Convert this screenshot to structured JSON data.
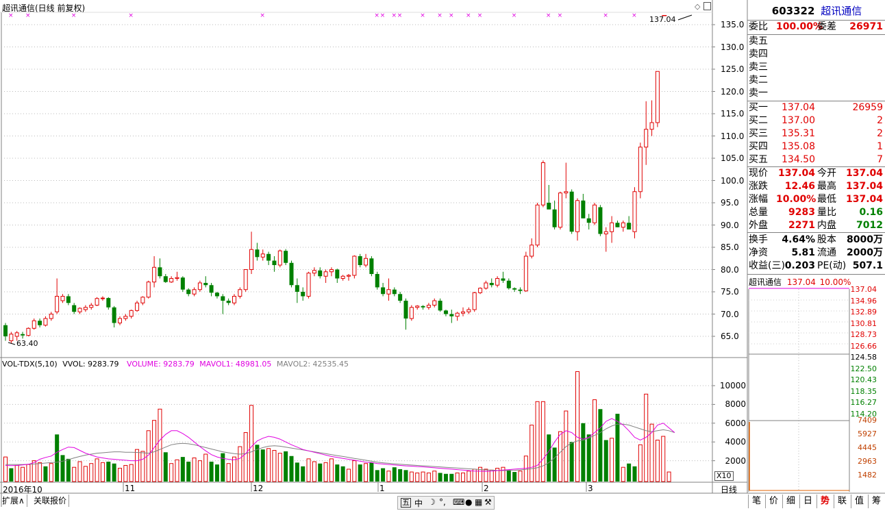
{
  "chart_header": {
    "title": "超讯通信(日线 前复权)"
  },
  "price_axis": [
    "135.0",
    "130.0",
    "125.0",
    "120.0",
    "115.0",
    "110.0",
    "105.0",
    "100.0",
    "95.0",
    "90.0",
    "85.0",
    "80.0",
    "75.0",
    "70.0",
    "65.0"
  ],
  "annotations": {
    "last_price": "137.04",
    "low_price": "63.40"
  },
  "volume_header": {
    "indicator": "VOL-TDX(5,10)",
    "vvol": "VVOL: 9283.79",
    "volume": "VOLUME: 9283.79",
    "mavol1": "MAVOL1: 48981.05",
    "mavol2": "MAVOL2: 42535.45"
  },
  "volume_axis": [
    "10000",
    "8000",
    "6000",
    "4000",
    "2000"
  ],
  "volume_unit": "X10",
  "date_axis": [
    "2016年10",
    "11",
    "12",
    "1",
    "2",
    "3"
  ],
  "period_label": "日线",
  "quote": {
    "code": "603322",
    "name": "超讯通信",
    "weibi_label": "委比",
    "weibi_value": "100.00%",
    "weicha_label": "委差",
    "weicha_value": "26971",
    "sell": [
      {
        "label": "卖五",
        "price": "",
        "vol": ""
      },
      {
        "label": "卖四",
        "price": "",
        "vol": ""
      },
      {
        "label": "卖三",
        "price": "",
        "vol": ""
      },
      {
        "label": "卖二",
        "price": "",
        "vol": ""
      },
      {
        "label": "卖一",
        "price": "",
        "vol": ""
      }
    ],
    "buy": [
      {
        "label": "买一",
        "price": "137.04",
        "vol": "26959"
      },
      {
        "label": "买二",
        "price": "137.00",
        "vol": "2"
      },
      {
        "label": "买三",
        "price": "135.31",
        "vol": "2"
      },
      {
        "label": "买四",
        "price": "135.08",
        "vol": "1"
      },
      {
        "label": "买五",
        "price": "134.50",
        "vol": "7"
      }
    ],
    "stats": [
      {
        "l1": "现价",
        "v1": "137.04",
        "l2": "今开",
        "v2": "137.04"
      },
      {
        "l1": "涨跌",
        "v1": "12.46",
        "l2": "最高",
        "v2": "137.04"
      },
      {
        "l1": "涨幅",
        "v1": "10.00%",
        "l2": "最低",
        "v2": "137.04"
      },
      {
        "l1": "总量",
        "v1": "9283",
        "l2": "量比",
        "v2": "0.16"
      },
      {
        "l1": "外盘",
        "v1": "2271",
        "l2": "内盘",
        "v2": "7012"
      }
    ],
    "stats2": [
      {
        "l1": "换手",
        "v1": "4.64%",
        "l2": "股本",
        "v2": "8000万"
      },
      {
        "l1": "净资",
        "v1": "5.81",
        "l2": "流通",
        "v2": "2000万"
      },
      {
        "l1": "收益(三)",
        "v1": "0.203",
        "l2": "PE(动)",
        "v2": "507.1"
      }
    ]
  },
  "mini_chart": {
    "name": "超讯通信",
    "price": "137.04",
    "pct": "10.00%",
    "price_ticks": [
      "137.04",
      "134.96",
      "132.89",
      "130.81",
      "128.73",
      "126.66",
      "124.58",
      "122.50",
      "120.43",
      "118.35",
      "116.27",
      "114.20"
    ],
    "vol_ticks": [
      "7409",
      "5927",
      "4445",
      "2963",
      "1482"
    ]
  },
  "bottom_tabs": {
    "expand": "扩展∧",
    "related": "关联报价"
  },
  "right_tabs": [
    "笔",
    "价",
    "细",
    "日",
    "势",
    "联",
    "值",
    "筹"
  ],
  "toolbar_icons": [
    "五",
    "中"
  ],
  "colors": {
    "up": "#e00000",
    "down": "#008000",
    "ma1": "#e000e0",
    "ma2": "#808080",
    "marker": "#e000e0"
  },
  "chart_data": {
    "type": "candlestick",
    "title": "超讯通信(日线 前复权)",
    "ylim": [
      62,
      137
    ],
    "x_labels": [
      "2016年10",
      "11",
      "12",
      "1",
      "2",
      "3"
    ],
    "candles": [
      [
        67.5,
        68,
        64,
        65
      ],
      [
        64,
        66,
        63.4,
        65.5
      ],
      [
        65,
        66.2,
        64,
        65.8
      ],
      [
        65.5,
        66,
        64.5,
        65.2
      ],
      [
        65.2,
        67,
        65,
        66.8
      ],
      [
        66.8,
        69,
        66.5,
        68.5
      ],
      [
        68.5,
        69,
        67,
        67.5
      ],
      [
        67.5,
        69.5,
        67.2,
        69
      ],
      [
        69,
        70.5,
        68.5,
        70
      ],
      [
        70.5,
        78,
        70,
        74
      ],
      [
        73,
        74.5,
        72.5,
        74
      ],
      [
        74,
        74.5,
        72,
        72.5
      ],
      [
        72,
        72.5,
        70,
        70.5
      ],
      [
        70.5,
        71.5,
        70,
        71.3
      ],
      [
        71,
        72,
        70.5,
        71.5
      ],
      [
        71.5,
        72.5,
        71,
        72
      ],
      [
        72,
        73.8,
        71.8,
        73.5
      ],
      [
        73.5,
        74,
        73,
        73.6
      ],
      [
        73.6,
        73.8,
        71,
        71.5
      ],
      [
        71.5,
        71.8,
        67,
        68
      ],
      [
        68,
        69.5,
        67.5,
        69
      ],
      [
        69,
        70,
        68.5,
        69.5
      ],
      [
        69.5,
        71,
        69,
        70.8
      ],
      [
        70.8,
        73,
        70.5,
        72.5
      ],
      [
        72.5,
        74,
        72,
        73.8
      ],
      [
        73.8,
        77.5,
        73.5,
        77.2
      ],
      [
        77.2,
        83,
        76,
        80.5
      ],
      [
        80.5,
        82.5,
        78,
        78.5
      ],
      [
        78.5,
        79,
        77,
        77.2
      ],
      [
        77.2,
        78.5,
        77,
        78
      ],
      [
        78,
        79.5,
        77.5,
        78.2
      ],
      [
        78.2,
        78.5,
        75,
        75.5
      ],
      [
        75.5,
        75.8,
        74,
        74.5
      ],
      [
        74.5,
        76,
        74,
        75.5
      ],
      [
        75.5,
        77.5,
        75,
        77
      ],
      [
        77,
        78.5,
        76,
        76.5
      ],
      [
        76.5,
        77,
        74,
        74.8
      ],
      [
        74.8,
        75,
        73.5,
        74
      ],
      [
        74,
        74.5,
        70,
        73
      ],
      [
        73,
        73.5,
        72,
        72.5
      ],
      [
        72.5,
        74.5,
        72,
        74
      ],
      [
        74,
        76,
        73.5,
        75.5
      ],
      [
        75.5,
        80,
        75,
        80
      ],
      [
        80,
        88.5,
        79,
        84.5
      ],
      [
        84.5,
        86,
        82,
        82.8
      ],
      [
        82.8,
        84.5,
        82,
        83.5
      ],
      [
        83.5,
        84,
        81,
        82
      ],
      [
        82,
        83,
        79.5,
        81
      ],
      [
        81,
        84.5,
        80.5,
        84.2
      ],
      [
        84.2,
        84.6,
        81,
        81.5
      ],
      [
        81.5,
        82,
        76,
        76.5
      ],
      [
        76.5,
        78,
        72.5,
        75
      ],
      [
        75,
        76,
        73,
        74
      ],
      [
        74,
        79.5,
        73.5,
        79.2
      ],
      [
        79.2,
        80.5,
        78.5,
        79.8
      ],
      [
        79.8,
        80.5,
        78,
        78.5
      ],
      [
        78.5,
        80,
        77,
        79.5
      ],
      [
        79.5,
        80.5,
        78.5,
        80
      ],
      [
        80,
        80.2,
        77,
        78
      ],
      [
        78,
        78.8,
        77.5,
        78.5
      ],
      [
        78.5,
        79,
        77.5,
        78.7
      ],
      [
        78.7,
        83.2,
        78,
        83
      ],
      [
        83,
        83.5,
        80.5,
        81
      ],
      [
        81,
        83.5,
        80.5,
        82.5
      ],
      [
        82.5,
        83,
        78.5,
        79
      ],
      [
        79,
        79.5,
        75.5,
        76
      ],
      [
        76,
        77,
        74,
        74.5
      ],
      [
        74.5,
        78,
        73,
        75.5
      ],
      [
        75.5,
        76,
        74,
        74.5
      ],
      [
        74.5,
        75,
        72.5,
        73
      ],
      [
        73,
        73.5,
        66.5,
        69
      ],
      [
        69,
        72,
        68.5,
        71.5
      ],
      [
        71.5,
        72,
        71,
        71.8
      ],
      [
        71.8,
        72,
        71,
        71.5
      ],
      [
        71.5,
        72.5,
        71,
        72
      ],
      [
        72,
        73.5,
        71.5,
        73
      ],
      [
        73,
        73.5,
        70.5,
        70.8
      ],
      [
        70.8,
        71,
        69.5,
        70
      ],
      [
        70,
        71,
        68,
        69.5
      ],
      [
        69.5,
        70.5,
        68.5,
        70.2
      ],
      [
        70.2,
        71.5,
        69.5,
        70.5
      ],
      [
        70.5,
        71.5,
        70,
        71
      ],
      [
        71,
        75,
        70.5,
        74.8
      ],
      [
        74.8,
        76,
        74.5,
        75.8
      ],
      [
        75.8,
        77.5,
        75.5,
        77
      ],
      [
        77,
        78,
        76,
        76.5
      ],
      [
        76.5,
        78.5,
        76,
        78
      ],
      [
        78,
        79.5,
        77,
        77.5
      ],
      [
        77.5,
        78,
        75.5,
        75.8
      ],
      [
        75.8,
        76,
        75,
        75.5
      ],
      [
        75.5,
        76,
        74.5,
        75.2
      ],
      [
        75.2,
        84,
        75,
        83
      ],
      [
        83,
        87,
        82.5,
        85.5
      ],
      [
        85.5,
        95,
        85,
        94.5
      ],
      [
        94.5,
        104.5,
        94,
        104
      ],
      [
        95,
        99,
        94.5,
        93.5
      ],
      [
        93.5,
        95.5,
        89,
        89.5
      ],
      [
        89.5,
        97.5,
        89,
        97.2
      ],
      [
        97.2,
        104,
        96,
        97.5
      ],
      [
        97.5,
        98,
        88,
        88.5
      ],
      [
        88.5,
        96,
        86.5,
        95.5
      ],
      [
        95.5,
        97,
        91.5,
        91.5
      ],
      [
        91.5,
        92.5,
        89,
        90.5
      ],
      [
        90.5,
        95,
        90,
        94.5
      ],
      [
        94,
        94.5,
        87.5,
        88
      ],
      [
        88,
        89.5,
        84,
        88.5
      ],
      [
        88.5,
        92,
        86,
        90.5
      ],
      [
        90.5,
        91,
        89.5,
        89.5
      ],
      [
        89.5,
        91,
        88.5,
        90.5
      ],
      [
        90.5,
        92,
        90,
        89
      ],
      [
        88.5,
        98.5,
        87,
        97.5
      ],
      [
        97.5,
        108.5,
        96,
        107.5
      ],
      [
        107.5,
        117.8,
        103.5,
        111.5
      ],
      [
        111.5,
        118,
        110,
        113
      ],
      [
        113,
        124.5,
        112,
        124.5
      ]
    ],
    "ma1": [
      1500,
      1480,
      1500,
      1550,
      1620,
      1800,
      2150,
      2350,
      2500,
      2900,
      3200,
      3450,
      3400,
      3100,
      2800,
      2600,
      2400,
      2300,
      2200,
      2150,
      2100,
      2050,
      2000,
      2000,
      2150,
      2600,
      3400,
      4200,
      4800,
      5200,
      5200,
      4900,
      4500,
      4000,
      3500,
      3050,
      2650,
      2400,
      2250,
      2150,
      2100,
      2250,
      2750,
      3500,
      4100,
      4400,
      4600,
      4500,
      4300,
      4000,
      3700,
      3450,
      3200,
      3050,
      2900,
      2750,
      2600,
      2450,
      2350,
      2250,
      2150,
      2050,
      1950,
      1850,
      1800,
      1700,
      1650,
      1600,
      1550,
      1500,
      1450,
      1420,
      1380,
      1350,
      1300,
      1250,
      1200,
      1150,
      1100,
      1050,
      1000,
      950,
      900,
      880,
      870,
      900,
      950,
      1000,
      1050,
      1100,
      1150,
      1200,
      1300,
      1500,
      2200,
      3000,
      4000,
      4800,
      5200,
      5000,
      4500,
      4300,
      4500,
      5000,
      5500,
      6200,
      6500,
      6200,
      5800,
      5200,
      4500,
      4200,
      4500,
      5000,
      5800,
      6000,
      5500,
      5000
    ],
    "ma2": [
      1600,
      1600,
      1600,
      1600,
      1620,
      1650,
      1700,
      1750,
      1800,
      1850,
      1950,
      2100,
      2300,
      2450,
      2600,
      2700,
      2800,
      2850,
      2900,
      2950,
      2950,
      2900,
      2900,
      2880,
      2850,
      2800,
      2950,
      3200,
      3450,
      3700,
      3800,
      3850,
      3800,
      3700,
      3550,
      3400,
      3250,
      3100,
      2950,
      2850,
      2750,
      2700,
      2750,
      2950,
      3200,
      3400,
      3550,
      3600,
      3550,
      3450,
      3350,
      3250,
      3150,
      3050,
      2950,
      2850,
      2750,
      2650,
      2550,
      2450,
      2350,
      2250,
      2150,
      2050,
      1950,
      1850,
      1780,
      1720,
      1670,
      1620,
      1580,
      1540,
      1500,
      1460,
      1420,
      1380,
      1340,
      1300,
      1260,
      1220,
      1180,
      1140,
      1100,
      1060,
      1020,
      990,
      960,
      950,
      960,
      980,
      1020,
      1080,
      1150,
      1250,
      1450,
      1800,
      2300,
      2900,
      3500,
      3900,
      4100,
      4200,
      4400,
      4700,
      5000,
      5400,
      5700,
      5900,
      5900,
      5800,
      5600,
      5400,
      5200,
      5100,
      5200,
      5300,
      5200,
      5000
    ],
    "volumes": [
      [
        2400,
        1
      ],
      [
        1200,
        0
      ],
      [
        1500,
        1
      ],
      [
        1300,
        1
      ],
      [
        1600,
        1
      ],
      [
        2000,
        1
      ],
      [
        1800,
        1
      ],
      [
        1400,
        0
      ],
      [
        1700,
        1
      ],
      [
        4800,
        0
      ],
      [
        2600,
        0
      ],
      [
        2200,
        0
      ],
      [
        1300,
        1
      ],
      [
        1900,
        1
      ],
      [
        1400,
        1
      ],
      [
        1700,
        1
      ],
      [
        2200,
        1
      ],
      [
        1800,
        1
      ],
      [
        1900,
        0
      ],
      [
        1700,
        0
      ],
      [
        1200,
        1
      ],
      [
        1500,
        1
      ],
      [
        1600,
        1
      ],
      [
        3200,
        1
      ],
      [
        3000,
        1
      ],
      [
        5200,
        1
      ],
      [
        6300,
        1
      ],
      [
        7500,
        1
      ],
      [
        2900,
        0
      ],
      [
        1700,
        1
      ],
      [
        2100,
        1
      ],
      [
        2400,
        0
      ],
      [
        1900,
        0
      ],
      [
        2300,
        1
      ],
      [
        2000,
        1
      ],
      [
        2700,
        1
      ],
      [
        1900,
        0
      ],
      [
        1600,
        0
      ],
      [
        2800,
        0
      ],
      [
        1700,
        1
      ],
      [
        2400,
        1
      ],
      [
        3500,
        1
      ],
      [
        5000,
        1
      ],
      [
        7900,
        1
      ],
      [
        3700,
        0
      ],
      [
        3200,
        0
      ],
      [
        3300,
        1
      ],
      [
        3100,
        1
      ],
      [
        2800,
        1
      ],
      [
        3000,
        0
      ],
      [
        2500,
        0
      ],
      [
        1800,
        0
      ],
      [
        1400,
        0
      ],
      [
        2200,
        1
      ],
      [
        1900,
        1
      ],
      [
        1700,
        0
      ],
      [
        1800,
        1
      ],
      [
        2200,
        1
      ],
      [
        1600,
        0
      ],
      [
        1400,
        0
      ],
      [
        1100,
        1
      ],
      [
        2000,
        1
      ],
      [
        1600,
        0
      ],
      [
        1700,
        1
      ],
      [
        1800,
        0
      ],
      [
        1000,
        0
      ],
      [
        1200,
        0
      ],
      [
        900,
        1
      ],
      [
        1300,
        0
      ],
      [
        1100,
        0
      ],
      [
        1000,
        0
      ],
      [
        800,
        1
      ],
      [
        700,
        1
      ],
      [
        800,
        1
      ],
      [
        700,
        1
      ],
      [
        900,
        1
      ],
      [
        700,
        0
      ],
      [
        600,
        0
      ],
      [
        600,
        0
      ],
      [
        700,
        1
      ],
      [
        700,
        1
      ],
      [
        900,
        1
      ],
      [
        1100,
        1
      ],
      [
        1300,
        1
      ],
      [
        1100,
        1
      ],
      [
        1000,
        1
      ],
      [
        1200,
        1
      ],
      [
        1300,
        1
      ],
      [
        1000,
        0
      ],
      [
        800,
        0
      ],
      [
        900,
        1
      ],
      [
        2500,
        1
      ],
      [
        5800,
        1
      ],
      [
        8300,
        1
      ],
      [
        8300,
        1
      ],
      [
        4800,
        0
      ],
      [
        3400,
        0
      ],
      [
        5100,
        1
      ],
      [
        7300,
        1
      ],
      [
        4000,
        0
      ],
      [
        11500,
        1
      ],
      [
        6000,
        0
      ],
      [
        4800,
        0
      ],
      [
        8500,
        1
      ],
      [
        7500,
        0
      ],
      [
        4200,
        0
      ],
      [
        4400,
        1
      ],
      [
        7000,
        0
      ],
      [
        1300,
        1
      ],
      [
        1700,
        0
      ],
      [
        1400,
        0
      ],
      [
        3700,
        1
      ],
      [
        9100,
        1
      ],
      [
        5900,
        1
      ],
      [
        4200,
        1
      ],
      [
        4600,
        1
      ],
      [
        800,
        1
      ]
    ]
  }
}
